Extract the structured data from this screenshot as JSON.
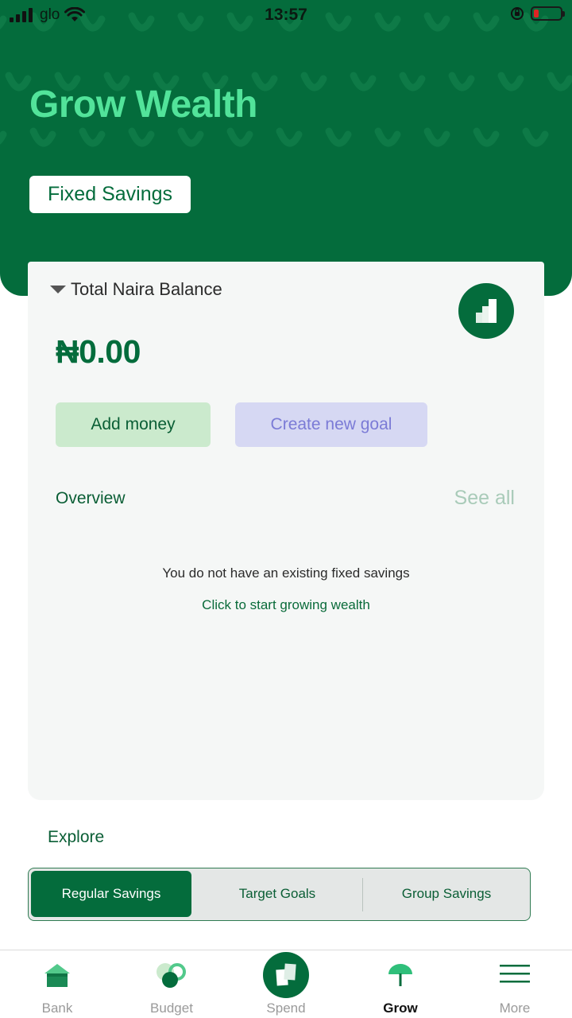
{
  "status_bar": {
    "carrier": "glo",
    "time": "13:57"
  },
  "header": {
    "title": "Grow Wealth",
    "chip_label": "Fixed Savings"
  },
  "balance_card": {
    "label": "Total Naira Balance",
    "amount": "₦0.00",
    "add_money_label": "Add money",
    "create_goal_label": "Create new goal",
    "overview_label": "Overview",
    "see_all_label": "See all",
    "empty_message": "You do not have an existing fixed savings",
    "start_link": "Click to start growing wealth"
  },
  "explore": {
    "label": "Explore",
    "tabs": [
      {
        "label": "Regular Savings",
        "active": true
      },
      {
        "label": "Target Goals",
        "active": false
      },
      {
        "label": "Group Savings",
        "active": false
      }
    ]
  },
  "bottom_nav": {
    "items": [
      {
        "label": "Bank",
        "icon": "home-icon"
      },
      {
        "label": "Budget",
        "icon": "budget-icon"
      },
      {
        "label": "Spend",
        "icon": "spend-icon"
      },
      {
        "label": "Grow",
        "icon": "umbrella-icon",
        "active": true
      },
      {
        "label": "More",
        "icon": "menu-icon"
      }
    ]
  },
  "colors": {
    "brand_green": "#046c3c",
    "accent_green": "#52e39a",
    "add_money_bg": "#cbeacd",
    "create_goal_bg": "#d6d8f3"
  }
}
